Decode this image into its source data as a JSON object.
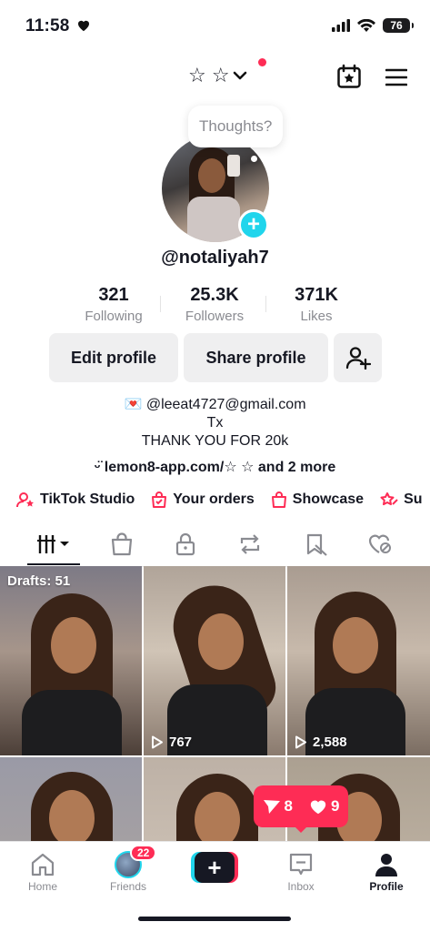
{
  "status_bar": {
    "time": "11:58",
    "battery": "76"
  },
  "header": {
    "account_name": "☆ ☆",
    "tooltip": "Thoughts?"
  },
  "profile": {
    "username": "@notaliyah7",
    "stats": [
      {
        "value": "321",
        "label": "Following"
      },
      {
        "value": "25.3K",
        "label": "Followers"
      },
      {
        "value": "371K",
        "label": "Likes"
      }
    ],
    "buttons": {
      "edit": "Edit profile",
      "share": "Share profile"
    },
    "bio": [
      "💌 @leeat4727@gmail.com",
      "Tx",
      "THANK YOU FOR 20k"
    ],
    "link": "ᵕ̈ lemon8-app.com/☆ ☆ and 2 more"
  },
  "quick_links": [
    {
      "label": "TikTok Studio",
      "icon": "studio-icon"
    },
    {
      "label": "Your orders",
      "icon": "orders-icon"
    },
    {
      "label": "Showcase",
      "icon": "showcase-icon"
    },
    {
      "label": "Su",
      "icon": "subscription-icon"
    }
  ],
  "grid": {
    "drafts_label": "Drafts: 51",
    "videos": [
      {
        "views": ""
      },
      {
        "views": "767"
      },
      {
        "views": "2,588"
      },
      {
        "views": ""
      },
      {
        "views": ""
      },
      {
        "views": ""
      }
    ]
  },
  "activity": {
    "shares": "8",
    "likes": "9"
  },
  "bottom_nav": {
    "home": "Home",
    "friends": "Friends",
    "friends_badge": "22",
    "inbox": "Inbox",
    "profile": "Profile"
  },
  "colors": {
    "accent_red": "#fe2c55",
    "accent_cyan": "#20d5ec",
    "text": "#161823",
    "muted": "#8a8b91"
  }
}
